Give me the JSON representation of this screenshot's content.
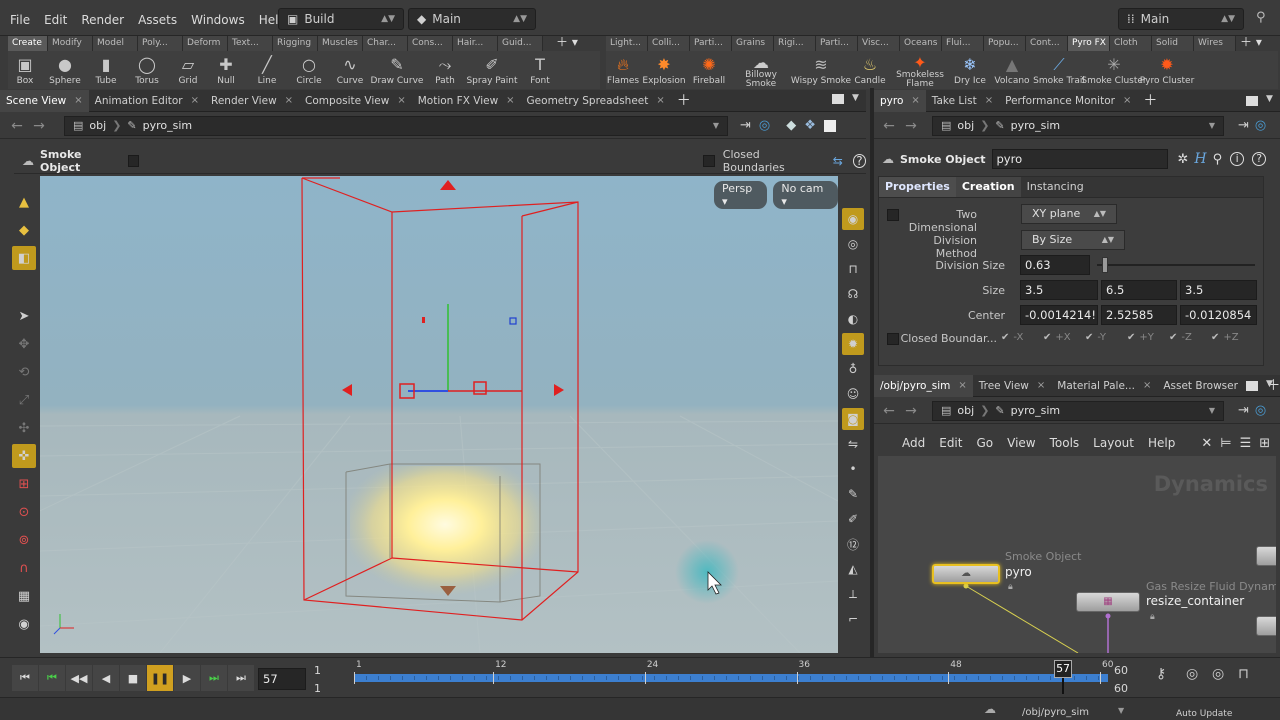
{
  "menubar": {
    "items": [
      "File",
      "Edit",
      "Render",
      "Assets",
      "Windows",
      "Help"
    ],
    "desktop_left": "Build",
    "desktop_center": "Main",
    "desktop_right": "Main"
  },
  "shelf_tabs_left": [
    "Create",
    "Modify",
    "Model",
    "Poly...",
    "Deform",
    "Text...",
    "Rigging",
    "Muscles",
    "Char...",
    "Cons...",
    "Hair...",
    "Guid..."
  ],
  "shelf_tabs_right": [
    "Light...",
    "Colli...",
    "Parti...",
    "Grains",
    "Rigi...",
    "Parti...",
    "Visc...",
    "Oceans",
    "Flui...",
    "Popu...",
    "Cont...",
    "Pyro FX",
    "Cloth",
    "Solid",
    "Wires"
  ],
  "shelf_tools_left": [
    {
      "label": "Box",
      "icon": "box-icon"
    },
    {
      "label": "Sphere",
      "icon": "sphere-icon"
    },
    {
      "label": "Tube",
      "icon": "tube-icon"
    },
    {
      "label": "Torus",
      "icon": "torus-icon"
    },
    {
      "label": "Grid",
      "icon": "grid-icon"
    },
    {
      "label": "Null",
      "icon": "null-icon"
    },
    {
      "label": "Line",
      "icon": "line-icon"
    },
    {
      "label": "Circle",
      "icon": "circle-icon"
    },
    {
      "label": "Curve",
      "icon": "curve-icon"
    },
    {
      "label": "Draw Curve",
      "icon": "draw-curve-icon"
    },
    {
      "label": "Path",
      "icon": "path-icon"
    },
    {
      "label": "Spray Paint",
      "icon": "spray-paint-icon"
    },
    {
      "label": "Font",
      "icon": "font-icon"
    }
  ],
  "shelf_tools_right": [
    {
      "label": "Flames",
      "icon": "flames-icon"
    },
    {
      "label": "Explosion",
      "icon": "explosion-icon"
    },
    {
      "label": "Fireball",
      "icon": "fireball-icon"
    },
    {
      "label": "Billowy Smoke",
      "icon": "billowy-smoke-icon"
    },
    {
      "label": "Wispy Smoke",
      "icon": "wispy-smoke-icon"
    },
    {
      "label": "Candle",
      "icon": "candle-icon"
    },
    {
      "label": "Smokeless Flame",
      "icon": "smokeless-flame-icon"
    },
    {
      "label": "Dry Ice",
      "icon": "dry-ice-icon"
    },
    {
      "label": "Volcano",
      "icon": "volcano-icon"
    },
    {
      "label": "Smoke Trail",
      "icon": "smoke-trail-icon"
    },
    {
      "label": "Smoke Cluster",
      "icon": "smoke-cluster-icon"
    },
    {
      "label": "Pyro Cluster",
      "icon": "pyro-cluster-icon"
    }
  ],
  "left_pane": {
    "tabs": [
      "Scene View",
      "Animation Editor",
      "Render View",
      "Composite View",
      "Motion FX View",
      "Geometry Spreadsheet"
    ],
    "path_root": "obj",
    "path_node": "pyro_sim",
    "operator_label": "Smoke Object",
    "closed_boundaries_label": "Closed Boundaries",
    "persp_label": "Persp",
    "cam_label": "No cam"
  },
  "right_top_pane": {
    "tabs": [
      "pyro",
      "Take List",
      "Performance Monitor"
    ],
    "path_root": "obj",
    "path_node": "pyro_sim",
    "node_type": "Smoke Object",
    "node_name": "pyro",
    "param_tabs": [
      "Properties",
      "Creation",
      "Instancing"
    ],
    "params": {
      "two_dimensional_label": "Two Dimensional",
      "two_dimensional_value": "XY plane",
      "division_method_label": "Division Method",
      "division_method_value": "By Size",
      "division_size_label": "Division Size",
      "division_size_value": "0.63",
      "size_label": "Size",
      "size_values": [
        "3.5",
        "6.5",
        "3.5"
      ],
      "center_label": "Center",
      "center_values": [
        "-0.0014214!",
        "2.52585",
        "-0.0120854"
      ],
      "closed_boundaries_label": "Closed Boundar...",
      "closed_axes": [
        "-X",
        "+X",
        "-Y",
        "+Y",
        "-Z",
        "+Z"
      ]
    }
  },
  "right_bottom_pane": {
    "tabs": [
      "/obj/pyro_sim",
      "Tree View",
      "Material Pale...",
      "Asset Browser"
    ],
    "path_root": "obj",
    "path_node": "pyro_sim",
    "menu": [
      "Add",
      "Edit",
      "Go",
      "View",
      "Tools",
      "Layout",
      "Help"
    ],
    "context_label": "Dynamics",
    "nodes": [
      {
        "type": "Smoke Object",
        "name": "pyro"
      },
      {
        "type": "Gas Resize Fluid Dynami",
        "name": "resize_container"
      }
    ]
  },
  "timeline": {
    "current_frame": "57",
    "start_frame": "1",
    "start_frame_2": "1",
    "end_frame": "60",
    "end_frame_2": "60",
    "ticks": [
      "1",
      "12",
      "24",
      "36",
      "48",
      "60"
    ],
    "range_start": 1,
    "range_end": 60,
    "playhead": 57,
    "marker_label": "57"
  },
  "status": {
    "path": "/obj/pyro_sim",
    "update_mode": "Auto Update"
  },
  "colors": {
    "accent": "#c09a1d",
    "timeline_bar": "#3c7fd0",
    "bbox_red": "#e02020"
  }
}
